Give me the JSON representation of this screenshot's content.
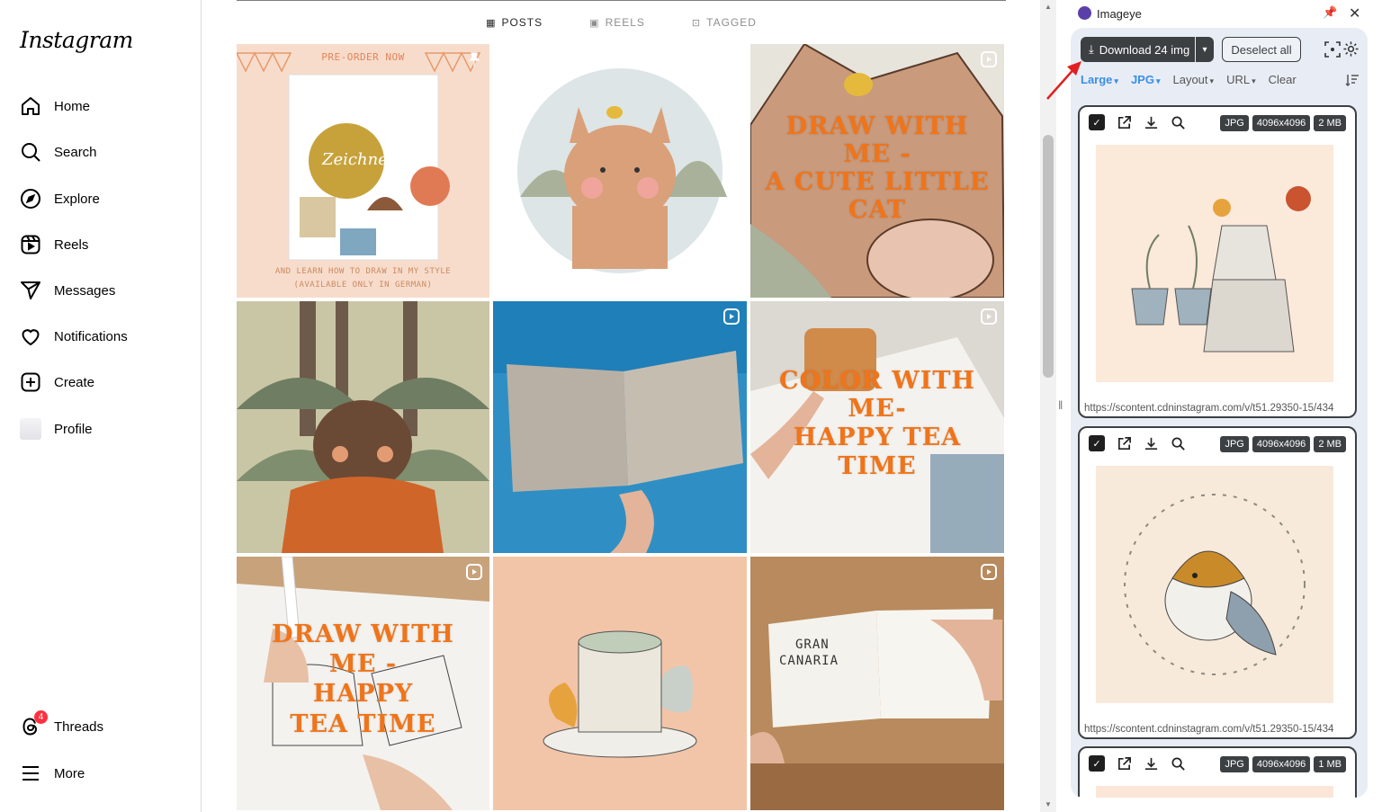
{
  "sidebar": {
    "logo": "Instagram",
    "items": [
      {
        "label": "Home",
        "icon": "home-icon"
      },
      {
        "label": "Search",
        "icon": "search-icon"
      },
      {
        "label": "Explore",
        "icon": "compass-icon"
      },
      {
        "label": "Reels",
        "icon": "reels-icon"
      },
      {
        "label": "Messages",
        "icon": "paper-plane-icon"
      },
      {
        "label": "Notifications",
        "icon": "heart-icon"
      },
      {
        "label": "Create",
        "icon": "plus-square-icon"
      },
      {
        "label": "Profile",
        "icon": "avatar"
      }
    ],
    "bottom": [
      {
        "label": "Threads",
        "icon": "threads-icon",
        "badge": "4"
      },
      {
        "label": "More",
        "icon": "hamburger-icon"
      }
    ]
  },
  "tabs": [
    {
      "label": "POSTS",
      "icon": "grid-icon",
      "active": true
    },
    {
      "label": "REELS",
      "icon": "reels-icon",
      "active": false
    },
    {
      "label": "TAGGED",
      "icon": "tag-icon",
      "active": false
    }
  ],
  "posts": {
    "p1": {
      "headline": "PRE-ORDER NOW",
      "book_title": "Zeichnen",
      "footer1": "AND LEARN HOW TO DRAW IN MY STYLE",
      "footer2": "(AVAILABLE ONLY IN GERMAN)"
    },
    "p3": {
      "overlay": "DRAW WITH ME - A CUTE LITTLE CAT",
      "lines": [
        "DRAW WITH",
        "ME -",
        "A CUTE LITTLE",
        "CAT"
      ]
    },
    "p6": {
      "lines": [
        "COLOR WITH",
        "ME-",
        "HAPPY TEA",
        "TIME"
      ]
    },
    "p7": {
      "lines": [
        "DRAW WITH",
        "ME -",
        "HAPPY",
        "TEA TIME"
      ]
    },
    "p9": {
      "sketch_text1": "GRAN",
      "sketch_text2": "CANARIA"
    }
  },
  "imageye": {
    "name": "Imageye",
    "download_label": "Download 24 img",
    "deselect_label": "Deselect all",
    "filters": [
      {
        "label": "Large",
        "accent": true
      },
      {
        "label": "JPG",
        "accent": true
      },
      {
        "label": "Layout",
        "accent": false
      },
      {
        "label": "URL",
        "accent": false
      },
      {
        "label": "Clear",
        "accent": false
      }
    ],
    "cards": [
      {
        "format": "JPG",
        "dimensions": "4096x4096",
        "size": "2 MB",
        "url": "https://scontent.cdninstagram.com/v/t51.29350-15/434"
      },
      {
        "format": "JPG",
        "dimensions": "4096x4096",
        "size": "2 MB",
        "url": "https://scontent.cdninstagram.com/v/t51.29350-15/434"
      },
      {
        "format": "JPG",
        "dimensions": "4096x4096",
        "size": "1 MB",
        "url": ""
      }
    ]
  },
  "colors": {
    "overlay_orange": "#f07419",
    "panel_bg": "#e8edf5",
    "accent_blue": "#3b8ee8",
    "badge_red": "#ff3040",
    "button_dark": "#3c4043"
  }
}
